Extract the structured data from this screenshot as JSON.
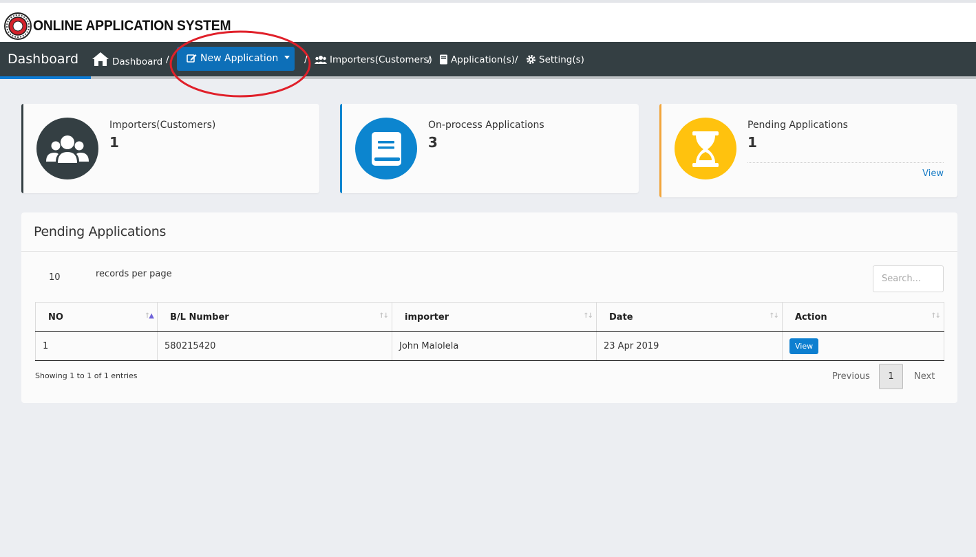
{
  "brand": {
    "title": "ONLINE APPLICATION SYSTEM"
  },
  "nav": {
    "title": "Dashboard",
    "breadcrumbs": [
      {
        "label": "Dashboard",
        "icon": "home-icon"
      },
      {
        "label": "Importers(Customers)",
        "icon": "users-icon"
      },
      {
        "label": "Application(s)",
        "icon": "book-icon"
      },
      {
        "label": "Setting(s)",
        "icon": "gear-icon"
      }
    ],
    "separator": "/",
    "new_application": {
      "label": "New Application",
      "icon": "edit-icon"
    }
  },
  "cards": [
    {
      "label": "Importers(Customers)",
      "value": "1",
      "icon": "users-icon",
      "color": "#343f43",
      "stripe": "#343f43"
    },
    {
      "label": "On-process Applications",
      "value": "3",
      "icon": "book-icon",
      "color": "#0c85cf",
      "stripe": "#0c85cf"
    },
    {
      "label": "Pending Applications",
      "value": "1",
      "icon": "hourglass-icon",
      "color": "#ffc20e",
      "stripe": "#f2a53a",
      "link": "View"
    }
  ],
  "panel": {
    "title": "Pending Applications",
    "page_length": "10",
    "page_length_label": "records per page",
    "search_placeholder": "Search...",
    "columns": [
      "NO",
      "B/L Number",
      "importer",
      "Date",
      "Action"
    ],
    "rows": [
      {
        "no": "1",
        "bl_number": "580215420",
        "importer": "John Malolela",
        "date": "23 Apr 2019",
        "action": "View"
      }
    ],
    "info": "Showing 1 to 1 of 1 entries",
    "pagination": {
      "previous": "Previous",
      "current": "1",
      "next": "Next"
    }
  },
  "colors": {
    "navbar": "#343f43",
    "primary": "#0d6fb8",
    "annotation": "#e0202a"
  }
}
